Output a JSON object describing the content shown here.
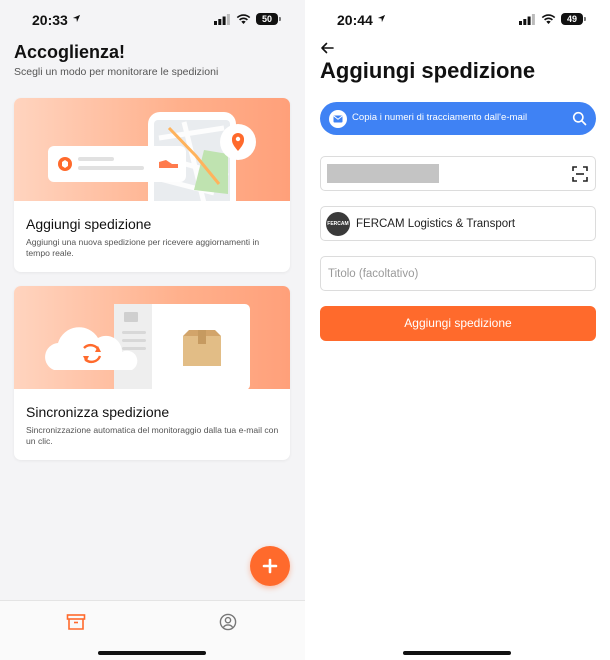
{
  "left": {
    "status": {
      "time": "20:33",
      "battery": "50"
    },
    "title": "Accoglienza!",
    "subtitle": "Scegli un modo per monitorare le spedizioni",
    "cards": [
      {
        "title": "Aggiungi spedizione",
        "description": "Aggiungi una nuova spedizione per ricevere aggiornamenti in tempo reale."
      },
      {
        "title": "Sincronizza spedizione",
        "description": "Sincronizzazione automatica del monitoraggio dalla tua e-mail con un clic."
      }
    ]
  },
  "right": {
    "status": {
      "time": "20:44",
      "battery": "49"
    },
    "title": "Aggiungi spedizione",
    "email_button_label": "Copia i numeri di tracciamento dall'e-mail",
    "carrier": {
      "logo_text": "FERCAM",
      "name": "FERCAM Logistics & Transport"
    },
    "title_field_placeholder": "Titolo (facoltativo)",
    "submit_label": "Aggiungi spedizione"
  },
  "colors": {
    "accent": "#ff6a2c",
    "blue": "#3f82f4"
  },
  "icons": [
    "location-arrow-icon",
    "signal-icon",
    "wifi-icon",
    "battery-icon",
    "pin-icon",
    "box-icon",
    "cloud-sync-icon",
    "mail-icon",
    "plus-icon",
    "package-tab-icon",
    "profile-icon",
    "back-arrow-icon",
    "search-icon",
    "scan-icon"
  ]
}
